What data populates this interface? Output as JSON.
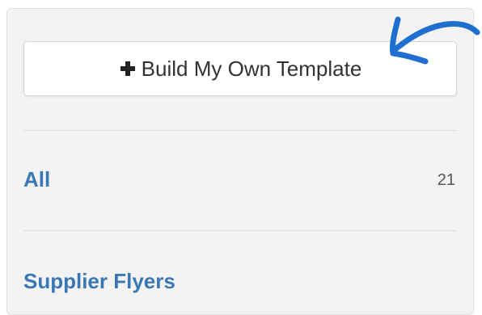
{
  "build_button": {
    "icon": "plus-icon",
    "label": "Build My Own Template"
  },
  "categories": [
    {
      "label": "All",
      "count": "21"
    },
    {
      "label": "Supplier Flyers"
    }
  ],
  "annotation": {
    "icon": "hand-drawn-arrow-icon",
    "color": "#1f6fd1"
  },
  "colors": {
    "panel_bg": "#f3f3f3",
    "link": "#3a78b5",
    "button_text": "#333333"
  }
}
